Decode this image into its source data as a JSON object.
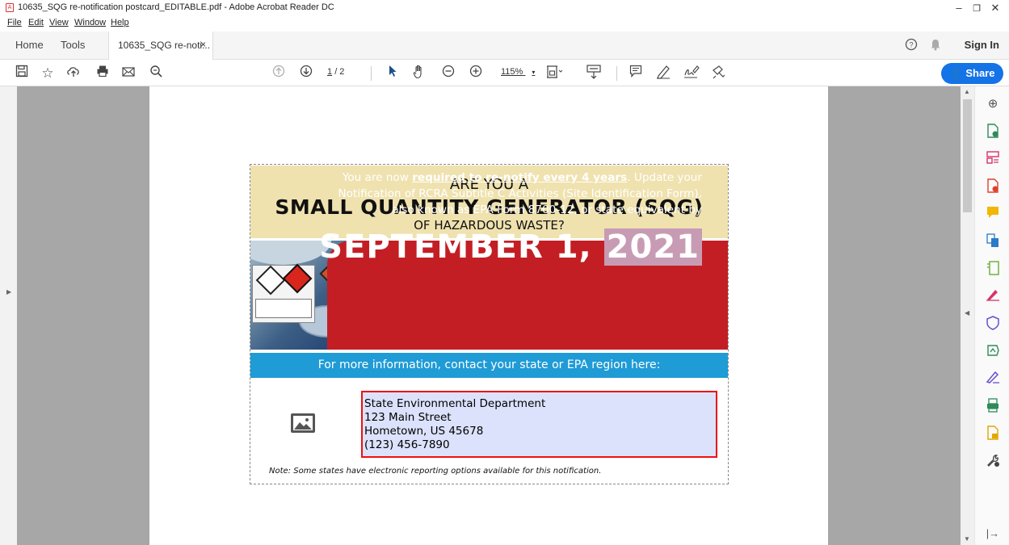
{
  "window": {
    "title": "10635_SQG re-notification postcard_EDITABLE.pdf - Adobe Acrobat Reader DC",
    "controls": [
      "–",
      "❐",
      "✕"
    ]
  },
  "menu": [
    "File",
    "Edit",
    "View",
    "Window",
    "Help"
  ],
  "tabs": {
    "home": "Home",
    "tools": "Tools",
    "document": "10635_SQG re-noti...",
    "close": "×",
    "sign_in": "Sign In"
  },
  "toolbar": {
    "page_current": "1",
    "page_total": "/ 2",
    "zoom": "115%",
    "share_label": "Share"
  },
  "postcard": {
    "header": {
      "line1": "ARE YOU A",
      "line2": "SMALL QUANTITY GENERATOR (SQG)",
      "line3": "OF HAZARDOUS WASTE?"
    },
    "notice": {
      "prefix": "You are now ",
      "emphasis": "required to re-notify every 4 years",
      "rest1": ". Update your",
      "line2": "Notification of RCRA Subtitle C Activities (Site Identification Form),",
      "line3": "also known as EPA Form 8700-12, or state equivalent by"
    },
    "deadline": {
      "date": "SEPTEMBER 1,",
      "year": "2021"
    },
    "contact_bar": "For more information, contact your state or EPA region here:",
    "address": {
      "line1": "State Environmental Department",
      "line2": "123 Main Street",
      "line3": "Hometown, US 45678",
      "line4": "(123) 456-7890"
    },
    "note": "Note: Some states have electronic reporting options available for this notification."
  },
  "colors": {
    "accent": "#1473e6",
    "header_bg": "#efe2af",
    "red_panel": "#c41e25",
    "blue_bar": "#1f9bd6",
    "field_bg": "#dce2fb"
  }
}
